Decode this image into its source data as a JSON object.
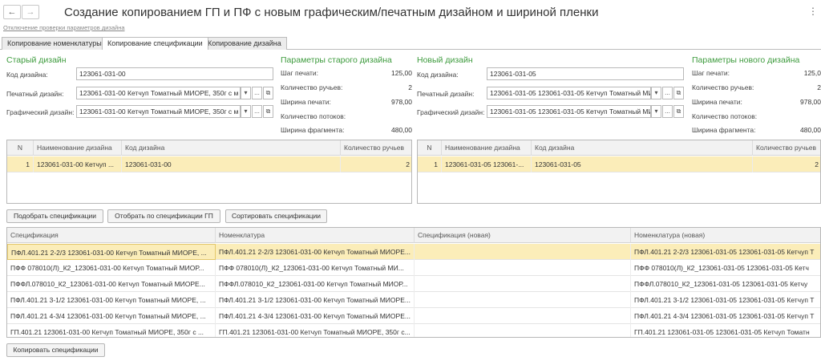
{
  "header": {
    "back_icon": "arrow-left-icon",
    "forward_icon": "arrow-right-icon",
    "title": "Создание копированием ГП и ПФ с новым графическим/печатным дизайном и шириной пленки",
    "menu_icon": "kebab-menu-icon",
    "link": "Отключение проверки параметров дизайна"
  },
  "tabs": [
    {
      "label": "Копирование номенклатуры"
    },
    {
      "label": "Копирование спецификации"
    },
    {
      "label": "Копирование дизайна"
    }
  ],
  "old_design": {
    "title": "Старый дизайн",
    "code_label": "Код дизайна:",
    "code_value": "123061-031-00",
    "print_label": "Печатный дизайн:",
    "print_value": "123061-031-00 Кетчуп Томатный МИОРЕ, 350г с м",
    "graphic_label": "Графический дизайн:",
    "graphic_value": "123061-031-00 Кетчуп Томатный МИОРЕ, 350г с м"
  },
  "old_params": {
    "title": "Параметры старого дизайна",
    "step_label": "Шаг печати:",
    "step_value": "125,00",
    "streams_label": "Количество ручьев:",
    "streams_value": "2",
    "width_label": "Ширина печати:",
    "width_value": "978,00",
    "flows_label": "Количество потоков:",
    "flows_value": "",
    "fragment_label": "Ширина фрагмента:",
    "fragment_value": "480,00"
  },
  "new_design": {
    "title": "Новый дизайн",
    "code_label": "Код дизайна:",
    "code_value": "123061-031-05",
    "print_label": "Печатный дизайн:",
    "print_value": "123061-031-05 123061-031-05 Кетчуп Томатный МИО",
    "graphic_label": "Графический дизайн:",
    "graphic_value": "123061-031-05 123061-031-05 Кетчуп Томатный МИО"
  },
  "new_params": {
    "title": "Параметры нового дизайна",
    "step_label": "Шаг печати:",
    "step_value": "125,0",
    "streams_label": "Количество ручьев:",
    "streams_value": "2",
    "width_label": "Ширина печати:",
    "width_value": "978,00",
    "flows_label": "Количество потоков:",
    "flows_value": "",
    "fragment_label": "Ширина фрагмента:",
    "fragment_value": "480,00"
  },
  "field_buttons": {
    "dropdown": "▾",
    "more": "...",
    "open": "⧉"
  },
  "old_table": {
    "columns": [
      "N",
      "Наименование дизайна",
      "Код дизайна",
      "Количество ручьев"
    ],
    "rows": [
      [
        "1",
        "123061-031-00 Кетчуп ...",
        "123061-031-00",
        "2"
      ]
    ]
  },
  "new_table": {
    "columns": [
      "N",
      "Наименование дизайна",
      "Код дизайна",
      "Количество ручьев"
    ],
    "rows": [
      [
        "1",
        "123061-031-05 123061-...",
        "123061-031-05",
        "2"
      ]
    ]
  },
  "actions": {
    "pick": "Подобрать спецификации",
    "filter": "Отобрать по спецификации ГП",
    "sort": "Сортировать спецификации"
  },
  "spec_table": {
    "columns": [
      "Спецификация",
      "Номенклатура",
      "Спецификация (новая)",
      "Номенклатура (новая)"
    ],
    "rows": [
      [
        "ПФЛ.401.21 2-2/3 123061-031-00 Кетчуп Томатный МИОРЕ, ...",
        "ПФЛ.401.21 2-2/3 123061-031-00 Кетчуп Томатный МИОРЕ...",
        "",
        "ПФЛ.401.21 2-2/3 123061-031-05 123061-031-05 Кетчуп Т"
      ],
      [
        "ПФФ 078010(Л)_К2_123061-031-00 Кетчуп Томатный МИОР...",
        "ПФФ 078010(Л)_К2_123061-031-00 Кетчуп Томатный МИ...",
        "",
        "ПФФ 078010(Л)_К2_123061-031-05 123061-031-05 Кетч"
      ],
      [
        "ПФФЛ.078010_К2_123061-031-00 Кетчуп Томатный МИОРЕ...",
        "ПФФЛ.078010_К2_123061-031-00 Кетчуп Томатный МИОР...",
        "",
        "ПФФЛ.078010_К2_123061-031-05 123061-031-05 Кетчу"
      ],
      [
        "ПФЛ.401.21 3-1/2 123061-031-00 Кетчуп Томатный МИОРЕ, ...",
        "ПФЛ.401.21 3-1/2 123061-031-00 Кетчуп Томатный МИОРЕ...",
        "",
        "ПФЛ.401.21 3-1/2 123061-031-05 123061-031-05 Кетчуп Т"
      ],
      [
        "ПФЛ.401.21 4-3/4 123061-031-00 Кетчуп Томатный МИОРЕ, ...",
        "ПФЛ.401.21 4-3/4 123061-031-00 Кетчуп Томатный МИОРЕ...",
        "",
        "ПФЛ.401.21 4-3/4 123061-031-05 123061-031-05 Кетчуп Т"
      ],
      [
        "ГП.401.21  123061-031-00 Кетчуп Томатный МИОРЕ, 350г с ...",
        "ГП.401.21  123061-031-00 Кетчуп Томатный МИОРЕ, 350г с...",
        "",
        "ГП.401.21  123061-031-05 123061-031-05 Кетчуп Томатн"
      ]
    ]
  },
  "copy_button": "Копировать спецификации",
  "colors": {
    "accent_green": "#3d9b3d",
    "selection": "#fbedb9"
  }
}
